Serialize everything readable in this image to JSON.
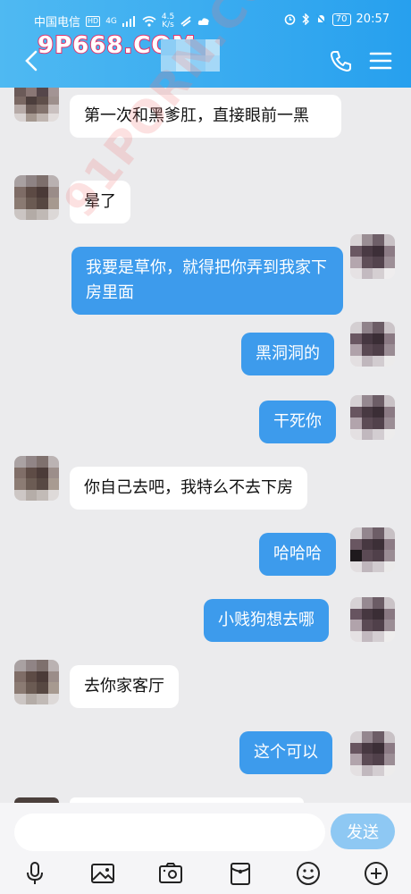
{
  "status_bar": {
    "carrier": "中国电信",
    "hd": "HD",
    "network": "4G",
    "speed": "4.5\nK/s",
    "battery": "70",
    "time": "20:57"
  },
  "watermark_logo": "9P668.COM",
  "diagonal_watermark": "91PORN.COM",
  "messages": [
    {
      "side": "in",
      "text": "第一次和黑爹肛，直接眼前一黑"
    },
    {
      "side": "in",
      "text": "晕了"
    },
    {
      "side": "out",
      "text": "我要是草你，就得把你弄到我家下房里面"
    },
    {
      "side": "out",
      "text": "黑洞洞的"
    },
    {
      "side": "out",
      "text": "干死你"
    },
    {
      "side": "in",
      "text": "你自己去吧，我特么不去下房"
    },
    {
      "side": "out",
      "text": "哈哈哈"
    },
    {
      "side": "out",
      "text": "小贱狗想去哪"
    },
    {
      "side": "in",
      "text": "去你家客厅"
    },
    {
      "side": "out",
      "text": "这个可以"
    }
  ],
  "input": {
    "value": "",
    "placeholder": ""
  },
  "send_label": "发送",
  "toolbar_icons": [
    "microphone-icon",
    "image-icon",
    "camera-icon",
    "red-packet-icon",
    "emoji-icon",
    "plus-icon"
  ],
  "colors": {
    "header": "#27a0ee",
    "outgoing_bubble": "#3d9bec",
    "incoming_bubble": "#ffffff",
    "send_button": "#8ec8f3"
  }
}
